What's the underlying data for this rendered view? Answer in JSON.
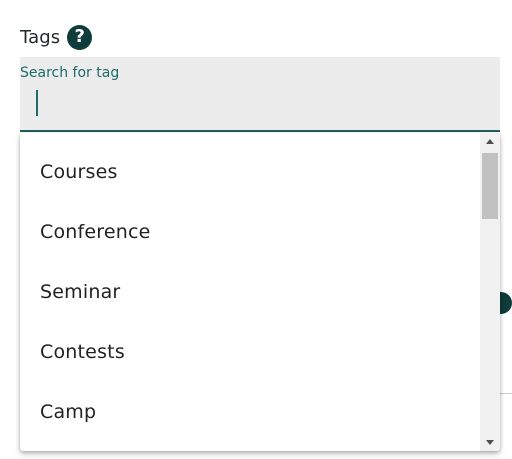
{
  "tags": {
    "label": "Tags",
    "help_glyph": "?"
  },
  "search": {
    "label": "Search for tag",
    "value": ""
  },
  "dropdown": {
    "options": [
      {
        "label": "Courses"
      },
      {
        "label": "Conference"
      },
      {
        "label": "Seminar"
      },
      {
        "label": "Contests"
      },
      {
        "label": "Camp"
      }
    ]
  },
  "colors": {
    "accent": "#1e6b6b",
    "dark": "#0f3b3a",
    "field_bg": "#ececec"
  }
}
